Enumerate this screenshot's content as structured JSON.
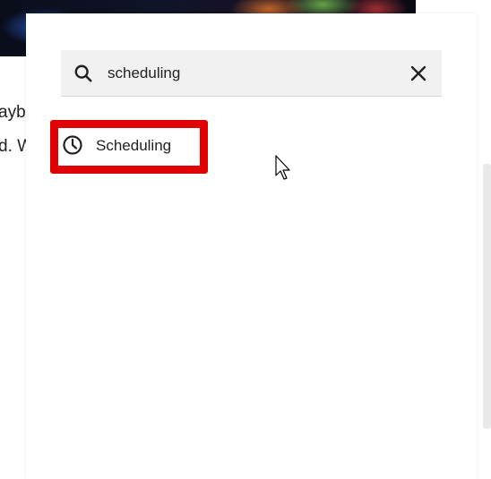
{
  "background": {
    "text_line_1": "ayb",
    "text_line_2": "d. W"
  },
  "search": {
    "query": "scheduling",
    "search_icon": "search-icon",
    "clear_icon": "close-icon"
  },
  "results": [
    {
      "label": "Scheduling",
      "icon": "clock-icon",
      "highlight_color": "#e00000"
    }
  ]
}
